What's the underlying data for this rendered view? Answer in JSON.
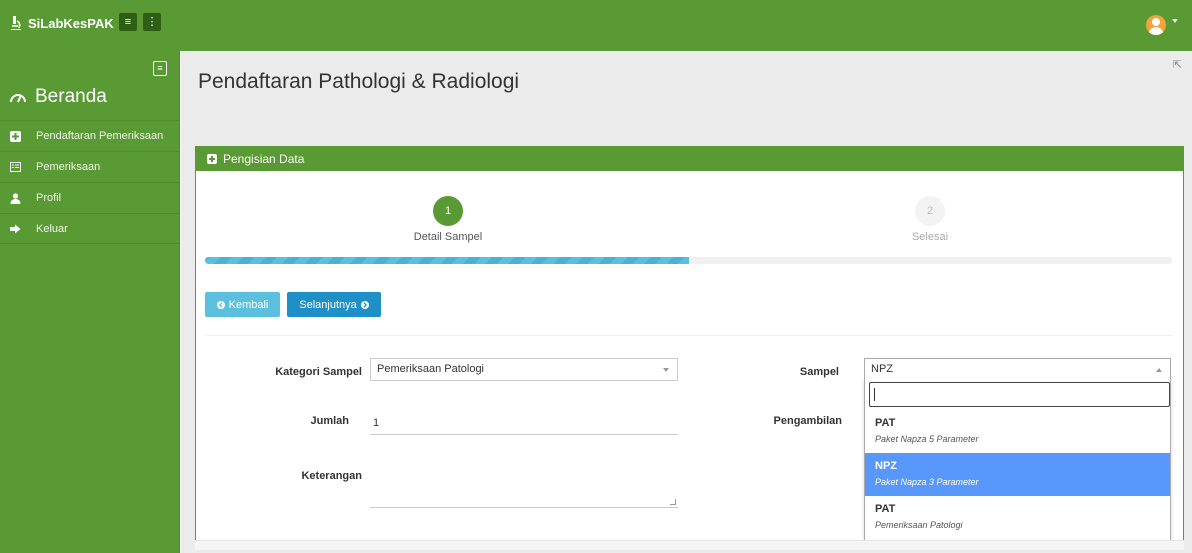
{
  "app": {
    "brand": "SiLabKesPAK"
  },
  "colors": {
    "primary_green": "#5a9a35",
    "info": "#5bc0de",
    "primary_blue": "#337ab7",
    "select_highlight": "#5897fb"
  },
  "sidebar": {
    "home": "Beranda",
    "items": [
      {
        "label": "Pendaftaran Pemeriksaan",
        "icon": "plus-square-icon"
      },
      {
        "label": "Pemeriksaan",
        "icon": "list-icon"
      },
      {
        "label": "Profil",
        "icon": "user-icon"
      },
      {
        "label": "Keluar",
        "icon": "sign-out-icon"
      }
    ]
  },
  "page": {
    "title": "Pendaftaran Pathologi & Radiologi"
  },
  "panel": {
    "title": "Pengisian Data",
    "steps": [
      {
        "number": "1",
        "label": "Detail Sampel",
        "active": true
      },
      {
        "number": "2",
        "label": "Selesai",
        "active": false
      }
    ],
    "progress": 0.5,
    "buttons": {
      "back": "Kembali",
      "next": "Selanjutnya"
    }
  },
  "form": {
    "kategori_label": "Kategori Sampel",
    "kategori_value": "Pemeriksaan Patologi",
    "jumlah_label": "Jumlah",
    "jumlah_value": "1",
    "keterangan_label": "Keterangan",
    "sampel_label": "Sampel",
    "sampel_value": "NPZ",
    "pengambilan_label": "Pengambilan"
  },
  "dropdown": {
    "search_value": "",
    "options": [
      {
        "code": "PAT",
        "desc": "Paket Napza 5 Parameter",
        "selected": false
      },
      {
        "code": "NPZ",
        "desc": "Paket Napza 3 Parameter",
        "selected": true
      },
      {
        "code": "PAT",
        "desc": "Pemeriksaan Patologi",
        "selected": false
      }
    ]
  }
}
